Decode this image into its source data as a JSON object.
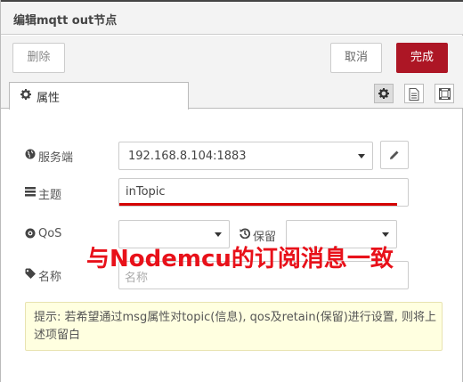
{
  "window": {
    "title": "编辑mqtt out节点"
  },
  "toolbar": {
    "delete_label": "删除",
    "cancel_label": "取消",
    "done_label": "完成"
  },
  "tabs": {
    "properties_label": "属性"
  },
  "form": {
    "server": {
      "label": "服务端",
      "value": "192.168.8.104:1883"
    },
    "topic": {
      "label": "主题",
      "value": "inTopic"
    },
    "qos": {
      "label": "QoS",
      "value": ""
    },
    "retain": {
      "label": "保留",
      "value": ""
    },
    "name": {
      "label": "名称",
      "placeholder": "名称"
    }
  },
  "annotation": {
    "text": "与Nodemcu的订阅消息一致",
    "color": "#e8111a"
  },
  "tip": {
    "text": "提示: 若希望通过msg属性对topic(信息), qos及retain(保留)进行设置, 则将上述项留白"
  },
  "icons": [
    "gear-icon",
    "description-icon",
    "appearance-icon",
    "globe-icon",
    "topic-icon",
    "qos-icon",
    "history-icon",
    "tag-icon",
    "pencil-icon"
  ],
  "colors": {
    "accent": "#ad1625",
    "annotation": "#e8111a",
    "tip_bg": "#ffffe0"
  }
}
